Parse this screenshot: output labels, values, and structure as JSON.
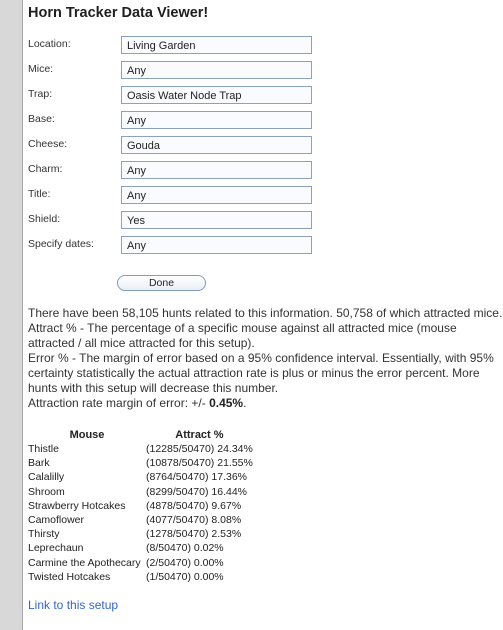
{
  "app": {
    "title": "Horn Tracker Data Viewer!"
  },
  "filters": [
    {
      "label": "Location:",
      "value": "Living Garden"
    },
    {
      "label": "Mice:",
      "value": "Any"
    },
    {
      "label": "Trap:",
      "value": "Oasis Water Node Trap"
    },
    {
      "label": "Base:",
      "value": "Any"
    },
    {
      "label": "Cheese:",
      "value": "Gouda"
    },
    {
      "label": "Charm:",
      "value": "Any"
    },
    {
      "label": "Title:",
      "value": "Any"
    },
    {
      "label": "Shield:",
      "value": "Yes"
    },
    {
      "label": "Specify dates:",
      "value": "Any"
    }
  ],
  "done_label": "Done",
  "info": {
    "hunts_text": "There have been 58,105 hunts related to this information. 50,758 of which attracted mice.",
    "attract_text": "Attract % - The percentage of a specific mouse against all attracted mice (mouse attracted / all mice attracted for this setup).",
    "error_text": "Error % - The margin of error based on a 95% confidence interval. Essentially, with 95% certainty statistically the actual attraction rate is plus or minus the error percent. More hunts with this setup will decrease this number.",
    "margin_prefix": "Attraction rate margin of error: +/- ",
    "margin_value": "0.45%",
    "margin_suffix": "."
  },
  "results": {
    "headers": [
      "Mouse",
      "Attract %"
    ],
    "rows": [
      {
        "mouse": "Thistle",
        "attract": "(12285/50470) 24.34%"
      },
      {
        "mouse": "Bark",
        "attract": "(10878/50470) 21.55%"
      },
      {
        "mouse": "Calalilly",
        "attract": "(8764/50470) 17.36%"
      },
      {
        "mouse": "Shroom",
        "attract": "(8299/50470) 16.44%"
      },
      {
        "mouse": "Strawberry Hotcakes",
        "attract": "(4878/50470) 9.67%"
      },
      {
        "mouse": "Camoflower",
        "attract": "(4077/50470) 8.08%"
      },
      {
        "mouse": "Thirsty",
        "attract": "(1278/50470) 2.53%"
      },
      {
        "mouse": "Leprechaun",
        "attract": "(8/50470) 0.02%"
      },
      {
        "mouse": "Carmine the Apothecary",
        "attract": "(2/50470) 0.00%"
      },
      {
        "mouse": "Twisted Hotcakes",
        "attract": "(1/50470) 0.00%"
      }
    ]
  },
  "link_label": "Link to this setup"
}
